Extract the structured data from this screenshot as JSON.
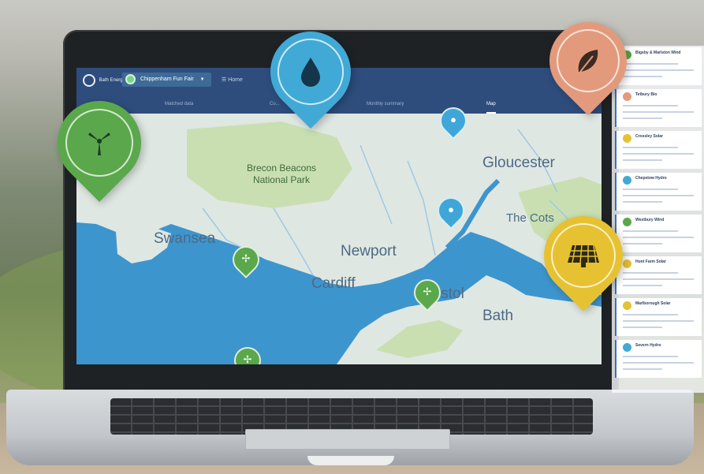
{
  "app": {
    "logo_text": "Bath Energy",
    "site_selector": "Chippenham Fun Fair",
    "header_link": "Home"
  },
  "tabs": [
    {
      "label": "Matched data",
      "active": false
    },
    {
      "label": "Co...",
      "active": false
    },
    {
      "label": "Monthly summary",
      "active": false
    },
    {
      "label": "Map",
      "active": true
    }
  ],
  "map": {
    "labels": {
      "gloucester": "Gloucester",
      "brecon": "Brecon Beacons",
      "national_park": "National Park",
      "swansea": "Swansea",
      "newport": "Newport",
      "cardiff": "Cardiff",
      "bristol": "istol",
      "bath": "Bath",
      "cotswolds": "The Cots"
    },
    "colors": {
      "sea": "#3d95ce",
      "land": "#dfe7e2",
      "park": "#c9dfb2",
      "rivers": "#9fc8e6"
    }
  },
  "floating_pins": [
    {
      "name": "wind-pin",
      "icon": "wind-turbine-icon",
      "color": "#5aa84b"
    },
    {
      "name": "hydro-pin",
      "icon": "water-drop-icon",
      "color": "#41a9d6"
    },
    {
      "name": "biomass-pin",
      "icon": "leaf-icon",
      "color": "#e39a7c"
    },
    {
      "name": "solar-pin",
      "icon": "solar-panel-icon",
      "color": "#e6c232"
    }
  ],
  "panel_cards": [
    {
      "title": "Bigsby & Marlston Wind",
      "color": "#5aa84b"
    },
    {
      "title": "Tetbury Bio",
      "color": "#e39a7c"
    },
    {
      "title": "Crossley Solar",
      "color": "#e6c232"
    },
    {
      "title": "Chepstow Hydro",
      "color": "#41a9d6"
    },
    {
      "title": "Westbury Wind",
      "color": "#5aa84b"
    },
    {
      "title": "Hunt Farm Solar",
      "color": "#e6c232"
    },
    {
      "title": "Marlborough Solar",
      "color": "#e6c232"
    },
    {
      "title": "Severn Hydro",
      "color": "#41a9d6"
    }
  ]
}
